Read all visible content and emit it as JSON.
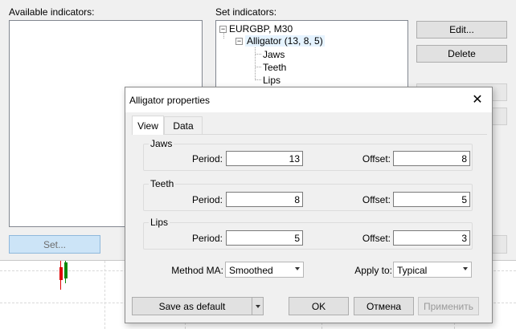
{
  "main": {
    "available_label": "Available indicators:",
    "set_label": "Set indicators:",
    "tree": {
      "root": "EURGBP, M30",
      "indicator": "Alligator (13, 8, 5)",
      "children": [
        "Jaws",
        "Teeth",
        "Lips"
      ]
    },
    "buttons": {
      "edit": "Edit...",
      "delete": "Delete",
      "set": "Set..."
    }
  },
  "props": {
    "title": "Alligator properties",
    "tabs": [
      "View",
      "Data"
    ],
    "groups": [
      {
        "title": "Jaws",
        "period_label": "Period:",
        "period": "13",
        "offset_label": "Offset:",
        "offset": "8"
      },
      {
        "title": "Teeth",
        "period_label": "Period:",
        "period": "8",
        "offset_label": "Offset:",
        "offset": "5"
      },
      {
        "title": "Lips",
        "period_label": "Period:",
        "period": "5",
        "offset_label": "Offset:",
        "offset": "3"
      }
    ],
    "method_label": "Method MA:",
    "method_value": "Smoothed",
    "apply_label": "Apply to:",
    "apply_value": "Typical",
    "buttons": {
      "save_default": "Save as default",
      "ok": "OK",
      "cancel": "Отмена",
      "apply": "Применить"
    }
  },
  "colors": {
    "candle_red": "#e00000",
    "candle_green": "#0a8a0a",
    "set_button_bg": "#cce4f7"
  }
}
